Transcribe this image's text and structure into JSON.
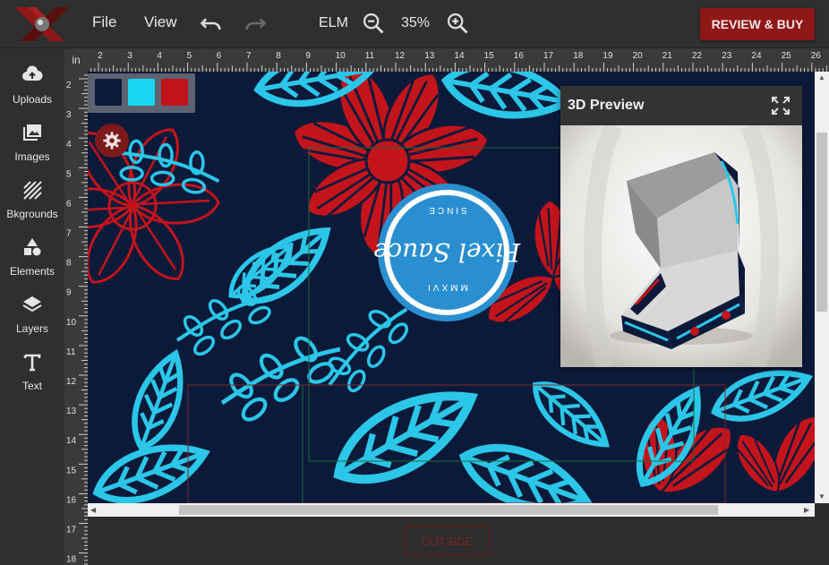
{
  "menu": {
    "file": "File",
    "view": "View",
    "elm": "ELM",
    "zoom": "35%"
  },
  "review_button": "REVIEW & BUY",
  "sidebar": {
    "items": [
      {
        "label": "Uploads",
        "icon": "cloud-upload-icon"
      },
      {
        "label": "Images",
        "icon": "images-icon"
      },
      {
        "label": "Bkgrounds",
        "icon": "backgrounds-icon"
      },
      {
        "label": "Elements",
        "icon": "shapes-icon"
      },
      {
        "label": "Layers",
        "icon": "layers-icon"
      },
      {
        "label": "Text",
        "icon": "text-icon"
      }
    ]
  },
  "ruler": {
    "unit": "in",
    "top_labels": [
      "2",
      "3",
      "4",
      "5",
      "6",
      "7",
      "8",
      "9",
      "10",
      "11",
      "12",
      "13",
      "14",
      "15",
      "16",
      "17",
      "18",
      "19",
      "20",
      "21",
      "22",
      "23",
      "24",
      "25",
      "26"
    ],
    "left_labels": [
      "2",
      "3",
      "4",
      "5",
      "6",
      "7",
      "8",
      "9",
      "10",
      "11",
      "12",
      "13",
      "14",
      "15",
      "16",
      "17",
      "18"
    ]
  },
  "swatches": [
    "#0c1a3a",
    "#18d6f2",
    "#c3141c"
  ],
  "colors": {
    "accent": "#8e1717",
    "navy": "#0c1a3a",
    "cyan": "#2bc6e8",
    "red": "#c3141c"
  },
  "logo_text": {
    "main": "Pixel Sauce",
    "top": "MMXVI",
    "bottom": "SINCE"
  },
  "preview": {
    "title": "3D Preview"
  },
  "outside_label": "OUTSIDE"
}
